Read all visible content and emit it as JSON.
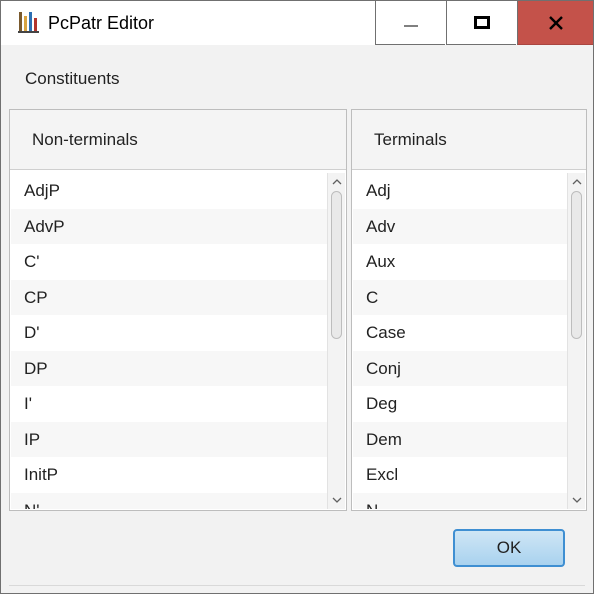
{
  "window": {
    "title": "PcPatr Editor",
    "controls": {
      "minimize": "minimize-icon",
      "maximize": "maximize-icon",
      "close": "close-icon"
    },
    "close_color": "#c4524a"
  },
  "section": {
    "heading": "Constituents"
  },
  "nonterminals": {
    "header": "Non-terminals",
    "items": [
      "AdjP",
      "AdvP",
      "C'",
      "CP",
      "D'",
      "DP",
      "I'",
      "IP",
      "InitP",
      "N'"
    ]
  },
  "terminals": {
    "header": "Terminals",
    "items": [
      "Adj",
      "Adv",
      "Aux",
      "C",
      "Case",
      "Conj",
      "Deg",
      "Dem",
      "Excl",
      "N"
    ]
  },
  "footer": {
    "ok_label": "OK"
  },
  "colors": {
    "accent": "#3f8fd2",
    "ok_fill": "#bcdcf2"
  }
}
